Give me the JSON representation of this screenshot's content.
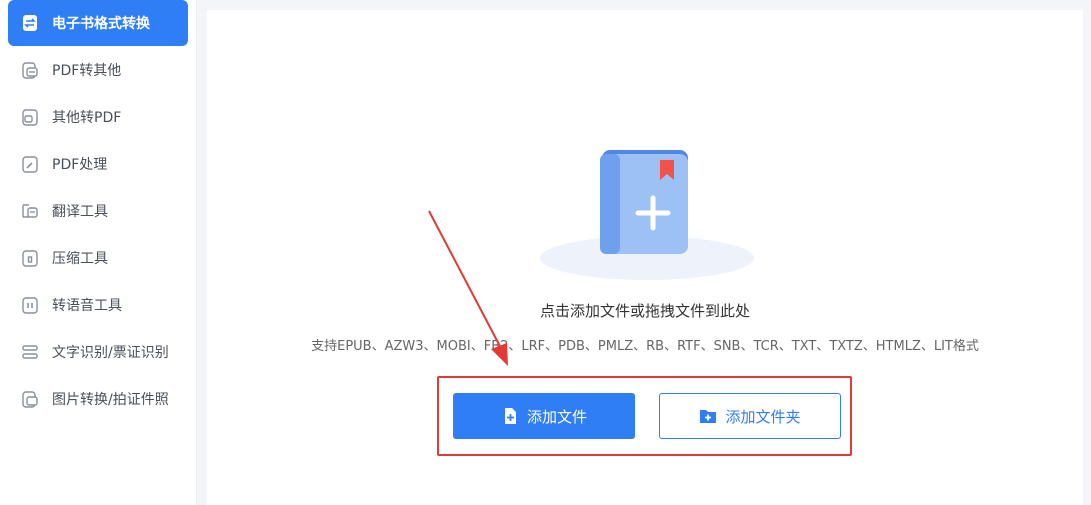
{
  "sidebar": {
    "items": [
      {
        "label": "电子书格式转换",
        "icon": "ebook-convert-icon",
        "active": true
      },
      {
        "label": "PDF转其他",
        "icon": "pdf-to-other-icon"
      },
      {
        "label": "其他转PDF",
        "icon": "other-to-pdf-icon"
      },
      {
        "label": "PDF处理",
        "icon": "pdf-edit-icon"
      },
      {
        "label": "翻译工具",
        "icon": "translate-icon"
      },
      {
        "label": "压缩工具",
        "icon": "compress-icon"
      },
      {
        "label": "转语音工具",
        "icon": "audio-icon"
      },
      {
        "label": "文字识别/票证识别",
        "icon": "ocr-icon"
      },
      {
        "label": "图片转换/拍证件照",
        "icon": "image-icon"
      }
    ]
  },
  "main": {
    "drop_hint": "点击添加文件或拖拽文件到此处",
    "formats": "支持EPUB、AZW3、MOBI、FB2、LRF、PDB、PMLZ、RB、RTF、SNB、TCR、TXT、TXTZ、HTMLZ、LIT格式",
    "add_file_label": "添加文件",
    "add_folder_label": "添加文件夹"
  },
  "colors": {
    "accent": "#2f7ef5",
    "highlight": "#e53935"
  }
}
